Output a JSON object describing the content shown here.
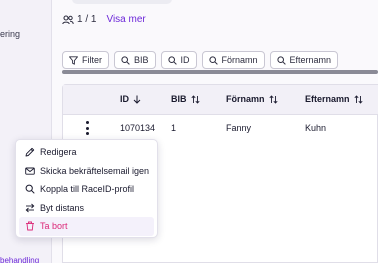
{
  "sidebar": {
    "item_partial": "ering",
    "bottom_partial": "behandling"
  },
  "header": {
    "count": "1 / 1",
    "show_more": "Visa mer"
  },
  "filters": {
    "filter_label": "Filter",
    "chips": [
      "BIB",
      "ID",
      "Förnamn",
      "Efternamn"
    ]
  },
  "table": {
    "columns": [
      "ID",
      "BIB",
      "Förnamn",
      "Efternamn"
    ],
    "rows": [
      {
        "id": "1070134",
        "bib": "1",
        "first_name": "Fanny",
        "last_name": "Kuhn"
      }
    ]
  },
  "context_menu": {
    "items": [
      {
        "label": "Redigera",
        "icon": "pencil-icon"
      },
      {
        "label": "Skicka bekräftelsemail igen",
        "icon": "mail-icon"
      },
      {
        "label": "Koppla till RaceID-profil",
        "icon": "search-icon"
      },
      {
        "label": "Byt distans",
        "icon": "swap-icon"
      },
      {
        "label": "Ta bort",
        "icon": "trash-icon"
      }
    ]
  },
  "colors": {
    "accent": "#6d28d9",
    "danger": "#db2777"
  }
}
